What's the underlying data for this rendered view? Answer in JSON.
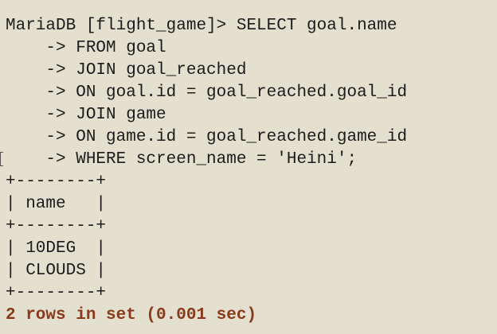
{
  "terminal": {
    "prompt_line": "MariaDB [flight_game]> SELECT goal.name",
    "continuation_lines": [
      "    -> FROM goal",
      "    -> JOIN goal_reached",
      "    -> ON goal.id = goal_reached.goal_id",
      "    -> JOIN game",
      "    -> ON game.id = goal_reached.game_id",
      "    -> WHERE screen_name = 'Heini';"
    ],
    "result_table": {
      "border_top": "+--------+",
      "header_row": "| name   |",
      "header_separator": "+--------+",
      "rows": [
        "| 10DEG  |",
        "| CLOUDS |"
      ],
      "border_bottom": "+--------+"
    },
    "status_line": "2 rows in set (0.001 sec)"
  },
  "colors": {
    "background": "#e3e0cf",
    "text": "#1b1b1b",
    "status": "#8a3a1a"
  }
}
